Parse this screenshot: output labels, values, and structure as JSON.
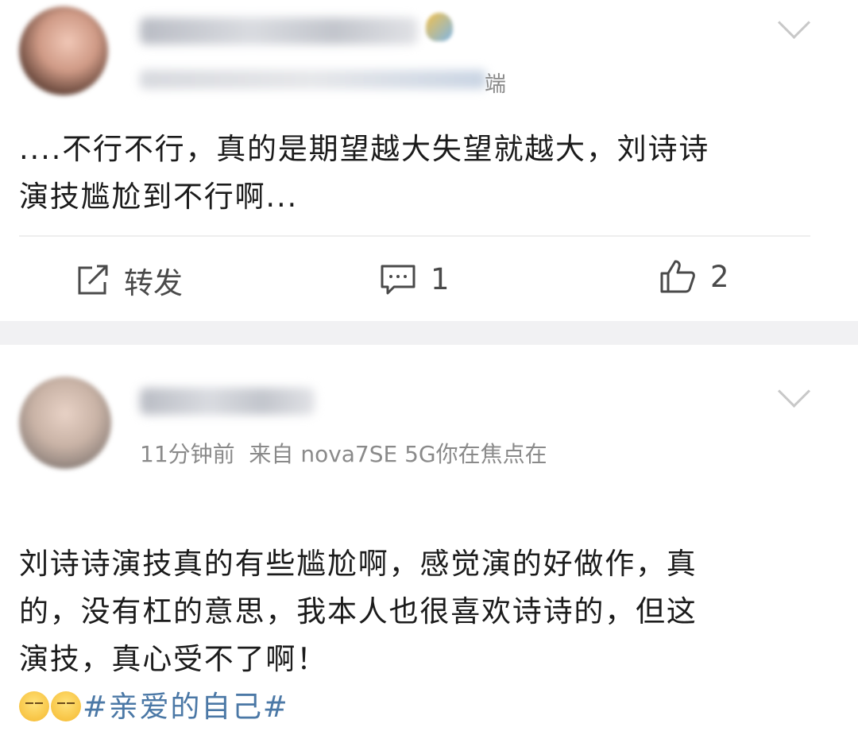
{
  "posts": [
    {
      "meta_suffix": "端",
      "content": "....不行不行，真的是期望越大失望就越大，刘诗诗\n演技尴尬到不行啊...",
      "actions": {
        "repost_label": "转发",
        "comment_count": "1",
        "like_count": "2"
      }
    },
    {
      "meta_text": "11分钟前  来自 nova7SE 5G你在焦点在",
      "content": "刘诗诗演技真的有些尴尬啊，感觉演的好做作，真\n的，没有杠的意思，我本人也很喜欢诗诗的，但这\n演技，真心受不了啊！",
      "hashtag": "#亲爱的自己#"
    }
  ],
  "icons": {
    "repost": "edit-share-icon",
    "comment": "comment-icon",
    "like": "thumbs-up-icon",
    "more": "chevron-down-icon",
    "emoji": "speechless-face-emoji"
  },
  "colors": {
    "hashtag": "#4b78a6",
    "separator": "#f1f1f3",
    "muted": "#8a8a8a"
  }
}
